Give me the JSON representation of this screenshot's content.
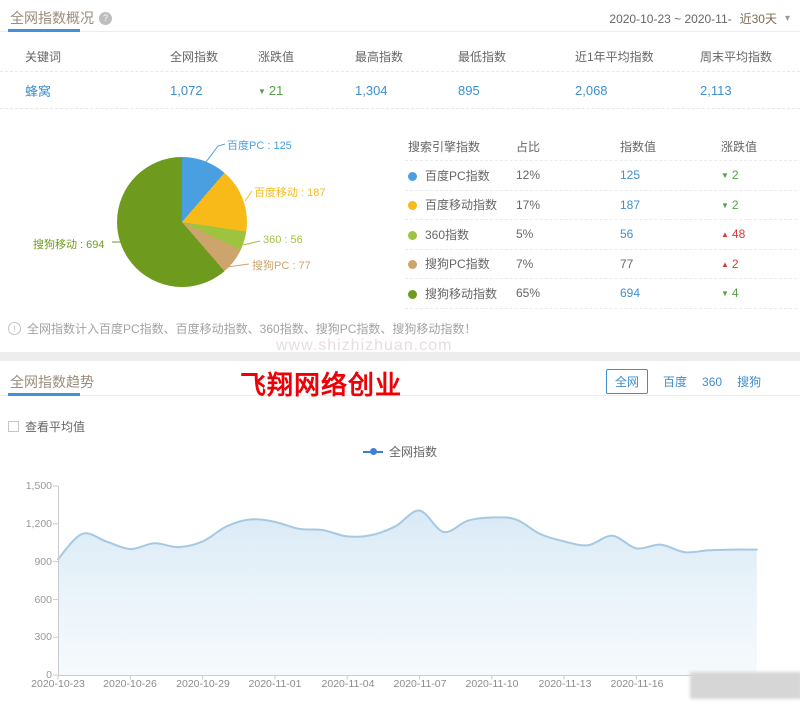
{
  "overview": {
    "title": "全网指数概况",
    "help_icon": "?",
    "date_range": "2020-10-23 ~ 2020-11-",
    "range_label": "近30天",
    "caret_icon": "▾",
    "table": {
      "headers": [
        "关键词",
        "全网指数",
        "涨跌值",
        "最高指数",
        "最低指数",
        "近1年平均指数",
        "周末平均指数"
      ],
      "row": {
        "keyword": "蜂窝",
        "index": "1,072",
        "change_arrow": "▼",
        "change": "21",
        "trend": "down",
        "highest": "1,304",
        "lowest": "895",
        "year_avg": "2,068",
        "weekend_avg": "2,113"
      }
    },
    "note_icon": "!",
    "note": "全网指数计入百度PC指数、百度移动指数、360指数、搜狗PC指数、搜狗移动指数！"
  },
  "engine_table": {
    "headers": [
      "搜索引擎指数",
      "占比",
      "指数值",
      "涨跌值"
    ],
    "rows": [
      {
        "name": "百度PC指数",
        "color": "#4a9fe0",
        "share": "12%",
        "value": "125",
        "value_color": "#3e8ed0",
        "arrow": "▼",
        "change": "2",
        "trend": "down"
      },
      {
        "name": "百度移动指数",
        "color": "#f7ba18",
        "share": "17%",
        "value": "187",
        "value_color": "#3e8ed0",
        "arrow": "▼",
        "change": "2",
        "trend": "down"
      },
      {
        "name": "360指数",
        "color": "#9ec43f",
        "share": "5%",
        "value": "56",
        "value_color": "#3e8ed0",
        "arrow": "▲",
        "change": "48",
        "trend": "up"
      },
      {
        "name": "搜狗PC指数",
        "color": "#cda46c",
        "share": "7%",
        "value": "77",
        "value_color": "#666666",
        "arrow": "▲",
        "change": "2",
        "trend": "up"
      },
      {
        "name": "搜狗移动指数",
        "color": "#6e9b1e",
        "share": "65%",
        "value": "694",
        "value_color": "#3e8ed0",
        "arrow": "▼",
        "change": "4",
        "trend": "down"
      }
    ]
  },
  "trend": {
    "title": "全网指数趋势",
    "tabs": [
      "全网",
      "百度",
      "360",
      "搜狗"
    ],
    "active_tab": "全网",
    "avg_label": "查看平均值",
    "legend": "全网指数",
    "legend_color": "#3e7fd6"
  },
  "watermarks": {
    "red_text": "飞翔网络创业",
    "red_color": "#ee0006",
    "faint_text": "www.shizhizhuan.com"
  },
  "chart_data": [
    {
      "type": "pie",
      "labels": [
        "百度PC",
        "百度移动",
        "360",
        "搜狗PC",
        "搜狗移动"
      ],
      "values": [
        125,
        187,
        56,
        77,
        694
      ],
      "shares_pct": [
        12,
        17,
        5,
        7,
        65
      ],
      "colors": [
        "#4a9fe0",
        "#f7ba18",
        "#9ec43f",
        "#cda46c",
        "#6e9b1e"
      ],
      "callouts": [
        "百度PC : 125",
        "百度移动 : 187",
        "360 : 56",
        "搜狗PC : 77",
        "搜狗移动 : 694"
      ],
      "legend_position": "none"
    },
    {
      "type": "area",
      "x": [
        "2020-10-23",
        "2020-10-24",
        "2020-10-25",
        "2020-10-26",
        "2020-10-27",
        "2020-10-28",
        "2020-10-29",
        "2020-10-30",
        "2020-10-31",
        "2020-11-01",
        "2020-11-02",
        "2020-11-03",
        "2020-11-04",
        "2020-11-05",
        "2020-11-06",
        "2020-11-07",
        "2020-11-08",
        "2020-11-09",
        "2020-11-10",
        "2020-11-11",
        "2020-11-12",
        "2020-11-13",
        "2020-11-14",
        "2020-11-15",
        "2020-11-16",
        "2020-11-17",
        "2020-11-18",
        "2020-11-19",
        "2020-11-20",
        "2020-11-21"
      ],
      "series": [
        {
          "name": "全网指数",
          "color": "#a5c9e2",
          "values": [
            920,
            1120,
            1060,
            1000,
            1045,
            1015,
            1060,
            1180,
            1235,
            1215,
            1160,
            1150,
            1100,
            1110,
            1180,
            1305,
            1135,
            1225,
            1250,
            1235,
            1120,
            1060,
            1030,
            1105,
            1005,
            1035,
            975,
            990,
            995,
            995
          ]
        }
      ],
      "ylim": [
        0,
        1500
      ],
      "yticks": [
        "0",
        "300",
        "600",
        "900",
        "1,200",
        "1,500"
      ],
      "xticks": [
        "2020-10-23",
        "2020-10-26",
        "2020-10-29",
        "2020-11-01",
        "2020-11-04",
        "2020-11-07",
        "2020-11-10",
        "2020-11-13",
        "2020-11-16"
      ],
      "grid": false,
      "legend_position": "top-center"
    }
  ]
}
